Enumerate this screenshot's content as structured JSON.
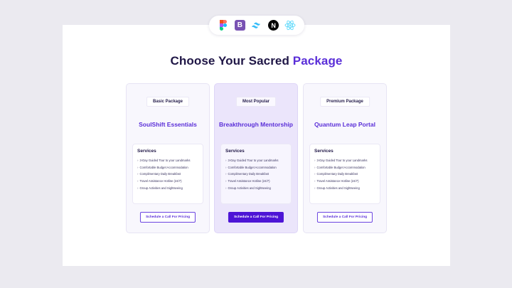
{
  "toolbar": {
    "tools": [
      "figma-icon",
      "bootstrap-icon",
      "tailwind-icon",
      "nextjs-icon",
      "react-icon"
    ],
    "colors": {
      "bootstrap": "#7952b3",
      "tailwind": "#38bdf8",
      "react": "#61dafb",
      "next": "#000000"
    },
    "bootstrap_glyph": "B",
    "next_glyph": "N"
  },
  "page": {
    "title_main": "Choose Your Sacred ",
    "title_accent": "Package",
    "accent_color": "#5a2ed8"
  },
  "cards": [
    {
      "badge": "Basic Package",
      "name": "SoulShift Essentials",
      "services_title": "Services",
      "services": [
        "3-Day Guided Tour to your Landmarks",
        "Comfortable Budget Accommodation",
        "Complimentary Daily Breakfast",
        "Travel Assistance Hotline (24/7)",
        "Group Activities and Sightseeing"
      ],
      "cta": "Schedule a Call For Pricing"
    },
    {
      "badge": "Most Popular",
      "name": "Breakthrough Mentorship",
      "services_title": "Services",
      "services": [
        "3-Day Guided Tour to your Landmarks",
        "Comfortable Budget Accommodation",
        "Complimentary Daily Breakfast",
        "Travel Assistance Hotline (24/7)",
        "Group Activities and Sightseeing"
      ],
      "cta": "Schedule a Call For Pricing"
    },
    {
      "badge": "Premium Package",
      "name": "Quantum Leap Portal",
      "services_title": "Services",
      "services": [
        "3-Day Guided Tour to your Landmarks",
        "Comfortable Budget Accommodation",
        "Complimentary Daily Breakfast",
        "Travel Assistance Hotline (24/7)",
        "Group Activities and Sightseeing"
      ],
      "cta": "Schedule a Call For Pricing"
    }
  ],
  "chevron": "›"
}
